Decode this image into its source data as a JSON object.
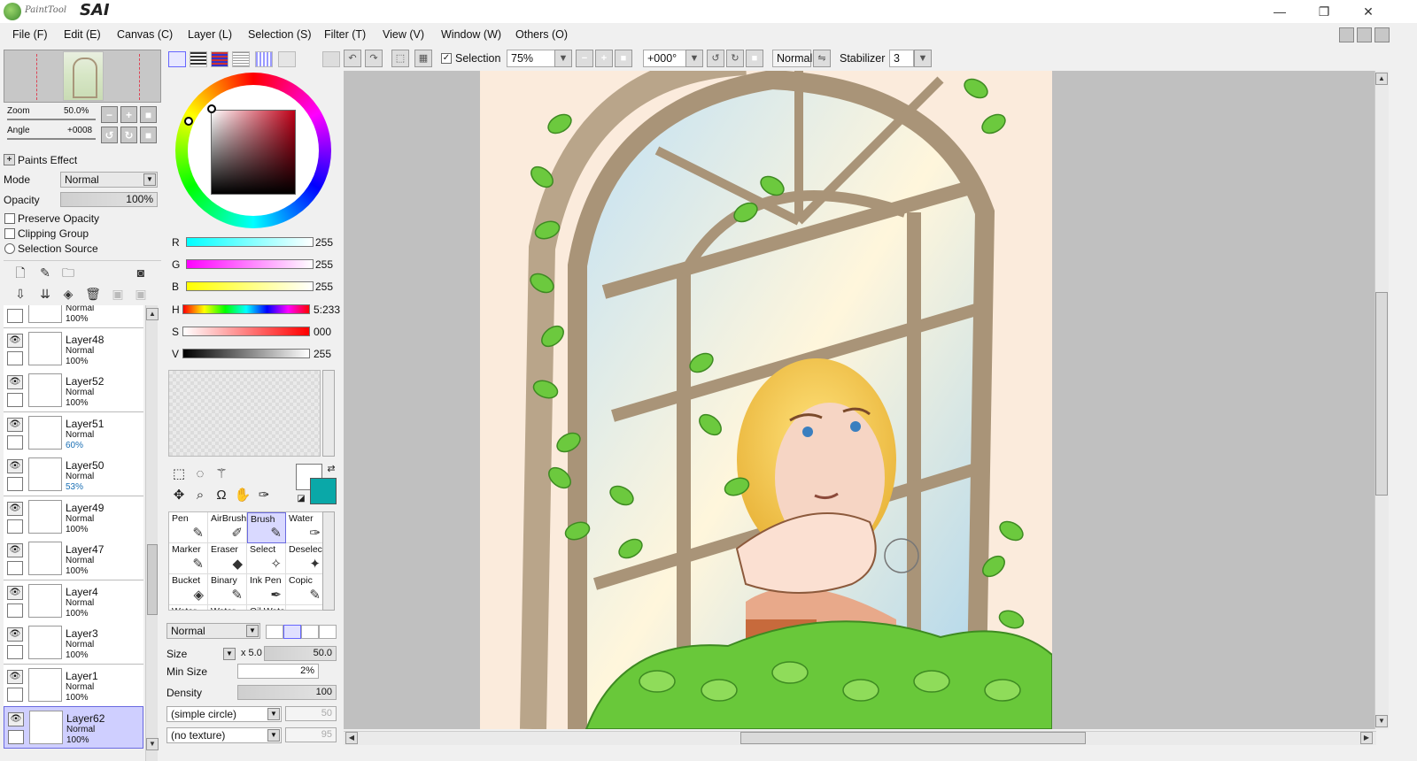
{
  "app": {
    "logo_small": "PaintTool",
    "logo_big": "SAI",
    "window_buttons": [
      "—",
      "❐",
      "✕"
    ]
  },
  "menu": [
    "File (F)",
    "Edit (E)",
    "Canvas (C)",
    "Layer (L)",
    "Selection (S)",
    "Filter (T)",
    "View (V)",
    "Window (W)",
    "Others (O)"
  ],
  "navigator": {
    "zoom_label": "Zoom",
    "zoom_value": "50.0%",
    "angle_label": "Angle",
    "angle_value": "+0008"
  },
  "layer_props": {
    "header": "Paints Effect",
    "mode_label": "Mode",
    "mode_value": "Normal",
    "opacity_label": "Opacity",
    "opacity_value": "100%",
    "preserve_opacity": "Preserve Opacity",
    "clipping_group": "Clipping Group",
    "selection_source": "Selection Source"
  },
  "layers": [
    {
      "name": "",
      "mode": "Normal",
      "opacity": "100%",
      "accent": false,
      "selected": false
    },
    {
      "name": "Layer48",
      "mode": "Normal",
      "opacity": "100%",
      "accent": false,
      "selected": false
    },
    {
      "name": "Layer52",
      "mode": "Normal",
      "opacity": "100%",
      "accent": false,
      "selected": false
    },
    {
      "name": "Layer51",
      "mode": "Normal",
      "opacity": "60%",
      "accent": true,
      "selected": false
    },
    {
      "name": "Layer50",
      "mode": "Normal",
      "opacity": "53%",
      "accent": true,
      "selected": false
    },
    {
      "name": "Layer49",
      "mode": "Normal",
      "opacity": "100%",
      "accent": false,
      "selected": false
    },
    {
      "name": "Layer47",
      "mode": "Normal",
      "opacity": "100%",
      "accent": false,
      "selected": false
    },
    {
      "name": "Layer4",
      "mode": "Normal",
      "opacity": "100%",
      "accent": false,
      "selected": false
    },
    {
      "name": "Layer3",
      "mode": "Normal",
      "opacity": "100%",
      "accent": false,
      "selected": false
    },
    {
      "name": "Layer1",
      "mode": "Normal",
      "opacity": "100%",
      "accent": false,
      "selected": false
    },
    {
      "name": "Layer62",
      "mode": "Normal",
      "opacity": "100%",
      "accent": false,
      "selected": true
    }
  ],
  "color": {
    "r_label": "R",
    "r_value": "255",
    "g_label": "G",
    "g_value": "255",
    "b_label": "B",
    "b_value": "255",
    "h_label": "H",
    "h_value": "5:233",
    "s_label": "S",
    "s_value": "000",
    "v_label": "V",
    "v_value": "255",
    "foreground": "#ffffff",
    "background": "#0aa8a8"
  },
  "brushes": [
    {
      "name": "Pen",
      "icon": "pen-icon",
      "glyph": "✎"
    },
    {
      "name": "AirBrush",
      "icon": "airbrush-icon",
      "glyph": "✐"
    },
    {
      "name": "Brush",
      "icon": "brush-icon",
      "glyph": "✎"
    },
    {
      "name": "Water",
      "icon": "water-icon",
      "glyph": "✑"
    },
    {
      "name": "Marker",
      "icon": "marker-icon",
      "glyph": "✎"
    },
    {
      "name": "Eraser",
      "icon": "eraser-icon",
      "glyph": "◆"
    },
    {
      "name": "Select",
      "icon": "select-icon",
      "glyph": "✧"
    },
    {
      "name": "Deselect",
      "icon": "deselect-icon",
      "glyph": "✦"
    },
    {
      "name": "Bucket",
      "icon": "bucket-icon",
      "glyph": "◈"
    },
    {
      "name": "Binary",
      "icon": "binary-icon",
      "glyph": "✎"
    },
    {
      "name": "Ink Pen",
      "icon": "ink-pen-icon",
      "glyph": "✒"
    },
    {
      "name": "Copic",
      "icon": "copic-icon",
      "glyph": "✎"
    },
    {
      "name": "Water",
      "icon": "water-icon",
      "glyph": ""
    },
    {
      "name": "Water",
      "icon": "water-icon",
      "glyph": ""
    },
    {
      "name": "Oil Wate",
      "icon": "oil-water-icon",
      "glyph": ""
    }
  ],
  "active_brush": "Brush",
  "brush_props": {
    "mode": "Normal",
    "size_label": "Size",
    "size_mult": "x 5.0",
    "size_value": "50.0",
    "min_size_label": "Min Size",
    "min_size_value": "2%",
    "density_label": "Density",
    "density_value": "100",
    "shape": "(simple circle)",
    "shape_value": "50",
    "texture": "(no texture)",
    "texture_value": "95"
  },
  "toolbar": {
    "selection_label": "Selection",
    "zoom_value": "75%",
    "angle_value": "+000°",
    "blend_mode": "Normal",
    "stabilizer_label": "Stabilizer",
    "stabilizer_value": "3"
  }
}
